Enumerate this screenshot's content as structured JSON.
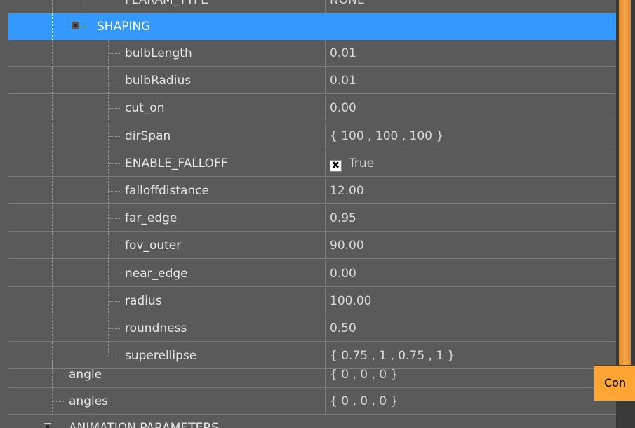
{
  "partial_top": {
    "name": "FLARAM_TYPE",
    "value": "NONE"
  },
  "group": {
    "label": "SHAPING"
  },
  "shaping_props": [
    {
      "name": "bulbLength",
      "value": "0.01"
    },
    {
      "name": "bulbRadius",
      "value": "0.01"
    },
    {
      "name": "cut_on",
      "value": "0.00"
    },
    {
      "name": "dirSpan",
      "value": "{ 100 , 100 , 100 }"
    },
    {
      "name": "ENABLE_FALLOFF",
      "value": "True",
      "checked": true
    },
    {
      "name": "falloffdistance",
      "value": "12.00"
    },
    {
      "name": "far_edge",
      "value": "0.95"
    },
    {
      "name": "fov_outer",
      "value": "90.00"
    },
    {
      "name": "near_edge",
      "value": "0.00"
    },
    {
      "name": "radius",
      "value": "100.00"
    },
    {
      "name": "roundness",
      "value": "0.50"
    },
    {
      "name": "superellipse",
      "value": "{ 0.75 , 1 , 0.75 , 1 }"
    }
  ],
  "root_props": [
    {
      "name": "angle",
      "value": "{ 0 , 0 , 0 }"
    },
    {
      "name": "angles",
      "value": "{ 0 , 0 , 0 }"
    }
  ],
  "partial_bottom": {
    "label": "ANIMATION PARAMETERS"
  },
  "tooltip": {
    "text": "Con"
  },
  "icons": {
    "checkbox": "checkmark-x-icon",
    "expander": "collapse-box-icon"
  },
  "colors": {
    "selection": "#3399ff",
    "panel": "#5a5a5a",
    "scrollbar_thumb": "#f6a74a",
    "tooltip": "#ffa534"
  }
}
